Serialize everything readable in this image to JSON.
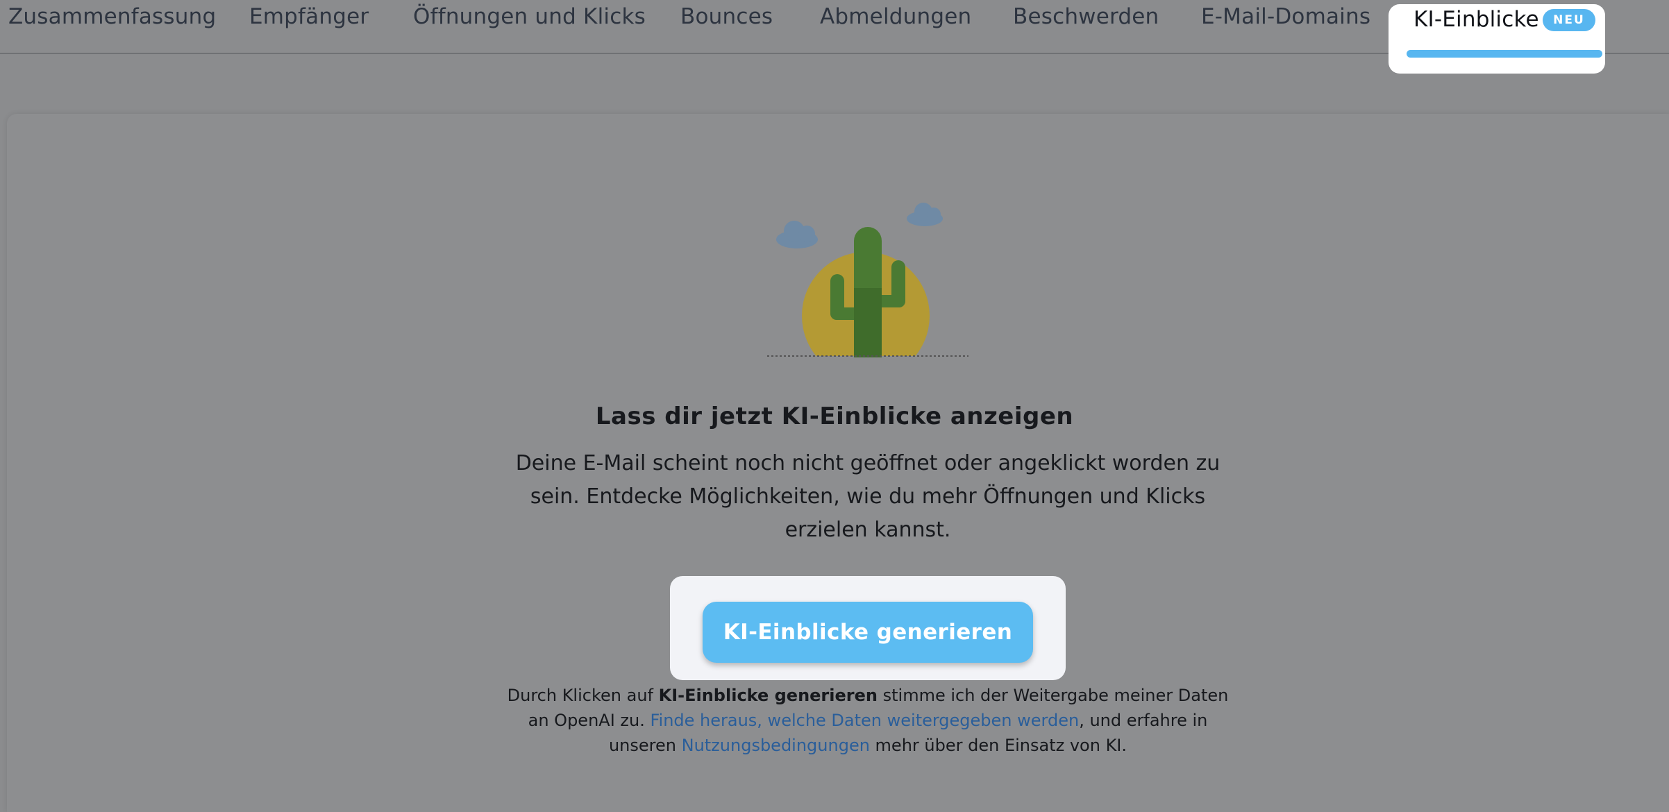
{
  "tabs": [
    {
      "label": "Zusammenfassung"
    },
    {
      "label": "Empfänger"
    },
    {
      "label": "Öffnungen und Klicks"
    },
    {
      "label": "Bounces"
    },
    {
      "label": "Abmeldungen"
    },
    {
      "label": "Beschwerden"
    },
    {
      "label": "E-Mail-Domains"
    },
    {
      "label": "KI-Einblicke",
      "badge": "NEU",
      "active": true
    }
  ],
  "empty_state": {
    "headline": "Lass dir jetzt KI-Einblicke anzeigen",
    "description": "Deine E-Mail scheint noch nicht geöffnet oder angeklickt worden zu sein. Entdecke Möglichkeiten, wie du mehr Öffnungen und Klicks erzielen kannst.",
    "button_label": "KI-Einblicke generieren",
    "illustration_icon": "cactus-desert-icon"
  },
  "consent": {
    "part1": "Durch Klicken auf ",
    "bold": "KI-Einblicke generieren",
    "part2": " stimme ich der Weitergabe meiner Daten an OpenAI zu. ",
    "link1": "Finde heraus, welche Daten weitergegeben werden",
    "part3": ", und erfahre in unseren ",
    "link2": "Nutzungsbedingungen",
    "part4": " mehr über den Einsatz von KI."
  },
  "colors": {
    "accent": "#57b6f0",
    "overlay": "#8b8c8e",
    "link": "#2a5e9a"
  }
}
